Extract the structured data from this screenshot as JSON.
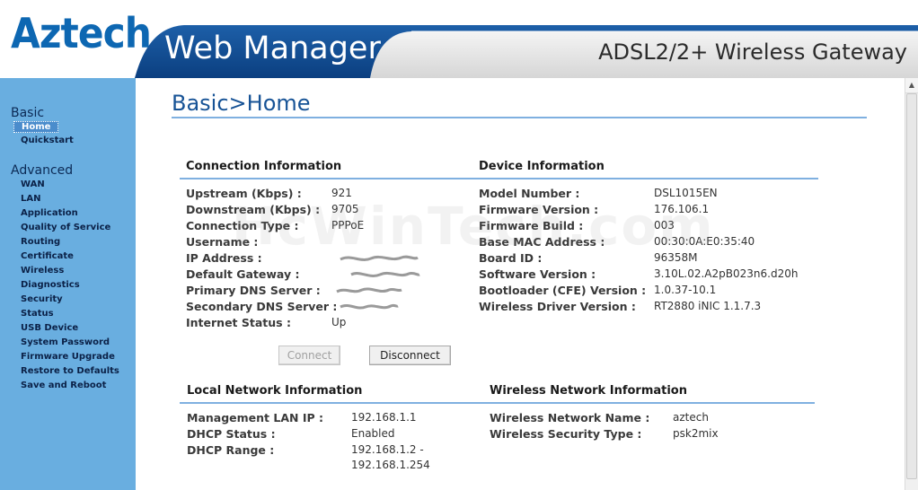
{
  "header": {
    "brand": "Aztech",
    "app_title": "Web Manager",
    "product_name": "ADSL2/2+ Wireless Gateway"
  },
  "sidebar": {
    "basic_label": "Basic",
    "basic_items": [
      "Home",
      "Quickstart"
    ],
    "advanced_label": "Advanced",
    "advanced_items": [
      "WAN",
      "LAN",
      "Application",
      "Quality of Service",
      "Routing",
      "Certificate",
      "Wireless",
      "Diagnostics",
      "Security",
      "Status",
      "USB Device",
      "System Password",
      "Firmware Upgrade",
      "Restore to Defaults",
      "Save and Reboot"
    ]
  },
  "page": {
    "title": "Basic>Home"
  },
  "connection": {
    "heading": "Connection Information",
    "rows": [
      {
        "label": "Upstream (Kbps) :",
        "value": "921"
      },
      {
        "label": "Downstream (Kbps) :",
        "value": "9705"
      },
      {
        "label": "Connection Type :",
        "value": "PPPoE"
      },
      {
        "label": "Username :",
        "value": ""
      },
      {
        "label": "IP Address :",
        "value": ""
      },
      {
        "label": "Default Gateway :",
        "value": ""
      },
      {
        "label": "Primary DNS Server :",
        "value": ""
      },
      {
        "label": "Secondary DNS Server :",
        "value": ""
      },
      {
        "label": "Internet Status :",
        "value": "Up"
      }
    ]
  },
  "device": {
    "heading": "Device Information",
    "rows": [
      {
        "label": "Model Number :",
        "value": "DSL1015EN"
      },
      {
        "label": "Firmware Version :",
        "value": "176.106.1"
      },
      {
        "label": "Firmware Build :",
        "value": "003"
      },
      {
        "label": "Base MAC Address :",
        "value": "00:30:0A:E0:35:40"
      },
      {
        "label": "Board ID :",
        "value": "96358M"
      },
      {
        "label": "Software Version :",
        "value": "3.10L.02.A2pB023n6.d20h"
      },
      {
        "label": "Bootloader (CFE) Version :",
        "value": "1.0.37-10.1"
      },
      {
        "label": "Wireless Driver Version :",
        "value": "RT2880 iNIC 1.1.7.3"
      }
    ]
  },
  "buttons": {
    "connect": "Connect",
    "disconnect": "Disconnect"
  },
  "local_network": {
    "heading": "Local Network Information",
    "rows": [
      {
        "label": "Management LAN IP :",
        "value": "192.168.1.1"
      },
      {
        "label": "DHCP Status :",
        "value": "Enabled"
      },
      {
        "label": "DHCP Range :",
        "value": "192.168.1.2 -",
        "value2": "192.168.1.254"
      }
    ]
  },
  "wireless_network": {
    "heading": "Wireless Network Information",
    "rows": [
      {
        "label": "Wireless Network Name :",
        "value": "aztech"
      },
      {
        "label": "Wireless Security Type :",
        "value": "psk2mix"
      }
    ]
  },
  "watermark": "HcWinTech.com",
  "colors": {
    "brand_blue": "#0d67b2",
    "sidebar_bg": "#69aee0",
    "title_blue": "#175396",
    "rule_blue": "#7fb0e0"
  }
}
